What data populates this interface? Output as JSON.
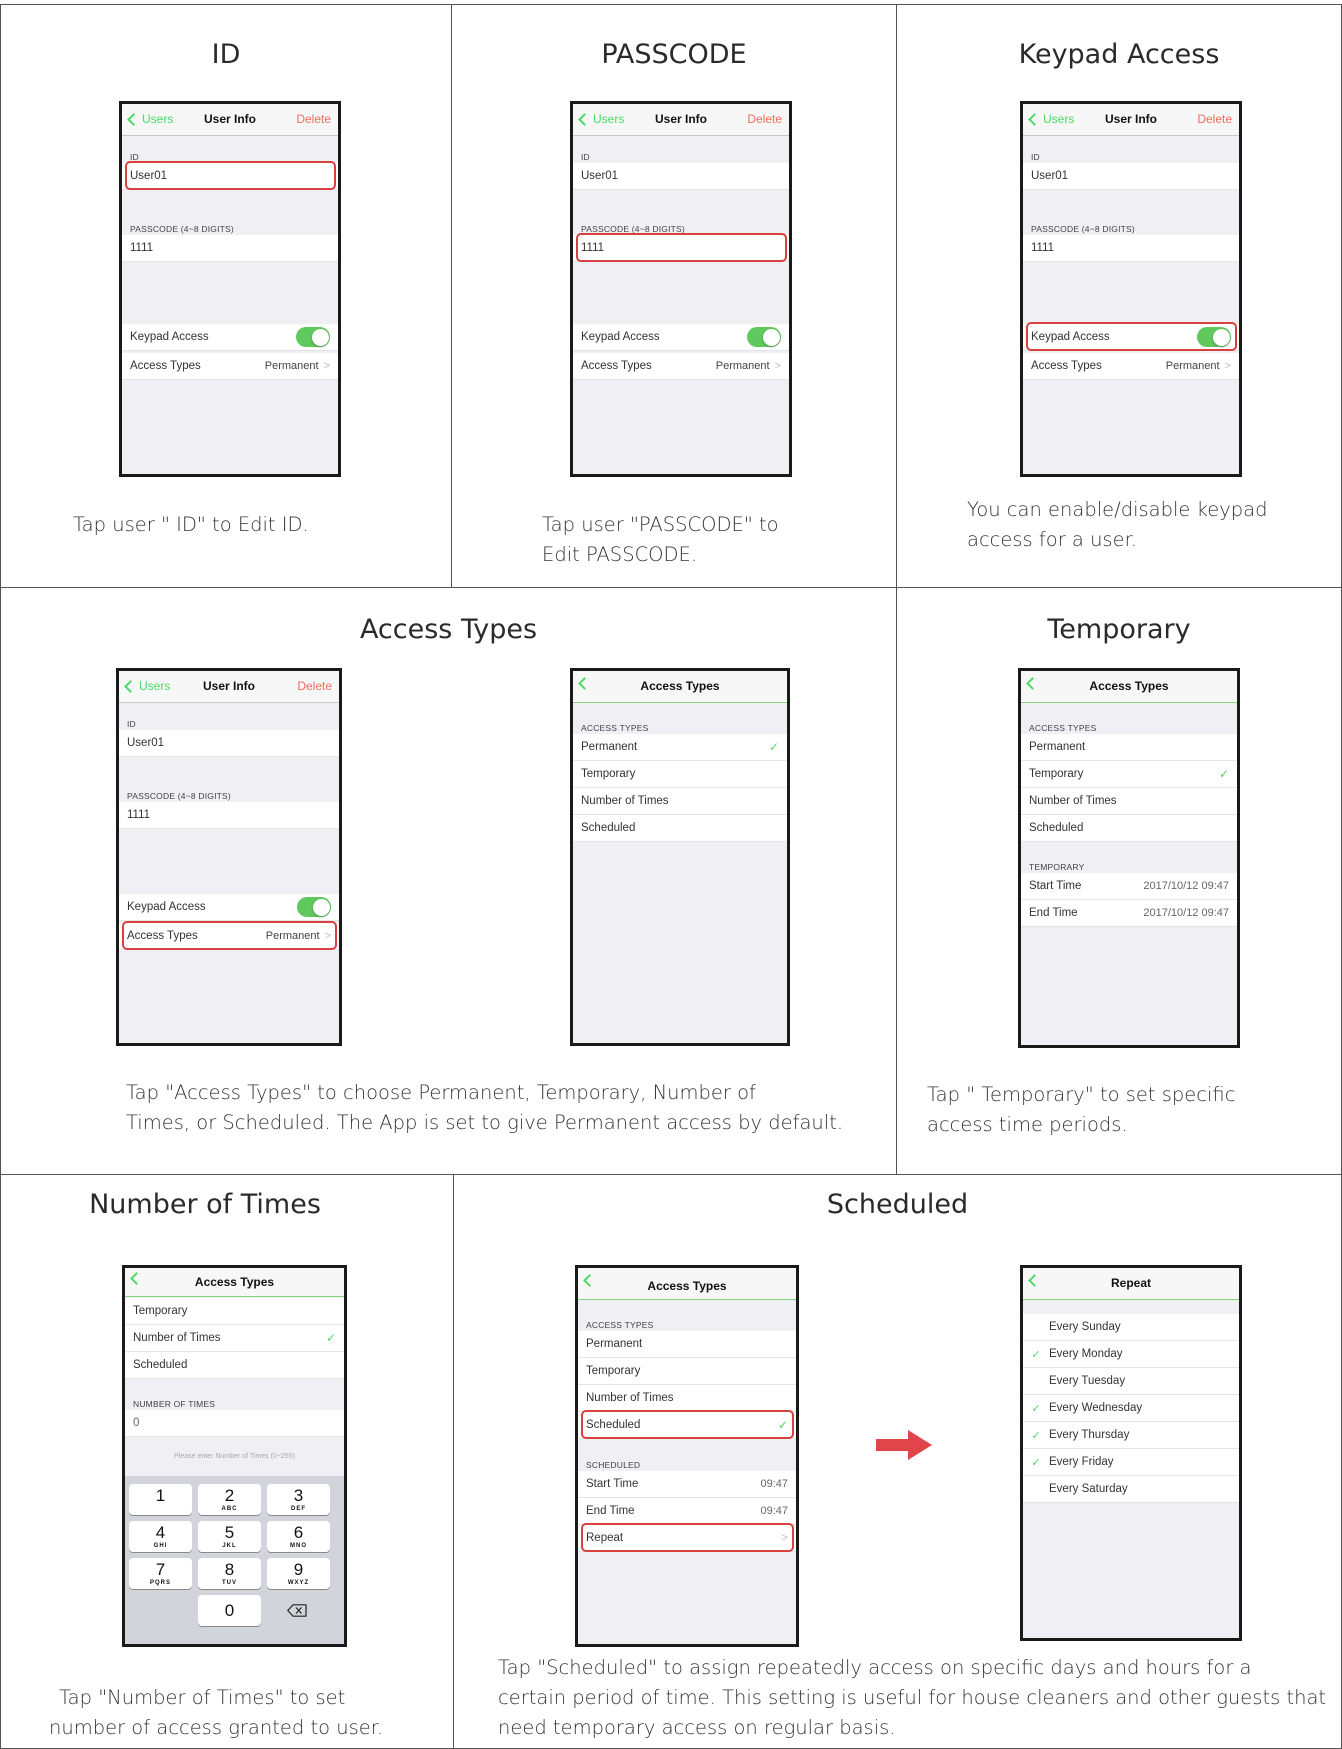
{
  "cells": {
    "id": {
      "title": "ID",
      "caption": "Tap user \" ID\" to Edit ID."
    },
    "passcode": {
      "title": "PASSCODE",
      "caption_line1": "Tap user \"PASSCODE\" to",
      "caption_line2": "Edit PASSCODE."
    },
    "keypad": {
      "title": "Keypad Access",
      "caption_line1": "You can enable/disable keypad",
      "caption_line2": "access for a user."
    },
    "access_types": {
      "title": "Access Types",
      "caption_line1": "Tap \"Access Types\" to choose Permanent, Temporary, Number of",
      "caption_line2": "Times, or Scheduled. The App is set to give Permanent access by default."
    },
    "temporary": {
      "title": "Temporary",
      "caption_line1": "Tap  \" Temporary\"  to set specific",
      "caption_line2": "access time periods."
    },
    "number_of_times": {
      "title": "Number of Times",
      "caption_line1": "Tap \"Number of Times\" to set",
      "caption_line2": "number of access granted to user."
    },
    "scheduled": {
      "title": "Scheduled",
      "caption_line1": "Tap  \"Scheduled\"  to assign repeatedly access on specific days and hours for a",
      "caption_line2": "certain period of time. This setting is useful for house cleaners and other guests that",
      "caption_line3": "need temporary access on regular basis."
    }
  },
  "user_info": {
    "back": "Users",
    "title": "User Info",
    "delete": "Delete",
    "id_label": "ID",
    "id_value": "User01",
    "passcode_label": "PASSCODE (4~8 DIGITS)",
    "passcode_value": "1111",
    "keypad_label": "Keypad Access",
    "access_types_label": "Access Types",
    "access_types_value": "Permanent"
  },
  "access_types_screen": {
    "title": "Access Types",
    "section": "ACCESS TYPES",
    "options": [
      "Permanent",
      "Temporary",
      "Number of Times",
      "Scheduled"
    ],
    "temporary_section": "TEMPORARY",
    "start_time_label": "Start Time",
    "end_time_label": "End Time",
    "temporary_start": "2017/10/12 09:47",
    "temporary_end": "2017/10/12 09:47",
    "number_section": "NUMBER OF TIMES",
    "number_value": "0",
    "number_hint": "Please enter Number of Times (0~255)",
    "scheduled_section": "SCHEDULED",
    "scheduled_start": "09:47",
    "scheduled_end": "09:47",
    "repeat_label": "Repeat",
    "check": "✓"
  },
  "keypad_keys": [
    {
      "num": "1",
      "sub": ""
    },
    {
      "num": "2",
      "sub": "ABC"
    },
    {
      "num": "3",
      "sub": "DEF"
    },
    {
      "num": "4",
      "sub": "GHI"
    },
    {
      "num": "5",
      "sub": "JKL"
    },
    {
      "num": "6",
      "sub": "MNO"
    },
    {
      "num": "7",
      "sub": "PQRS"
    },
    {
      "num": "8",
      "sub": "TUV"
    },
    {
      "num": "9",
      "sub": "WXYZ"
    },
    {
      "num": "0",
      "sub": ""
    }
  ],
  "repeat_screen": {
    "title": "Repeat",
    "days": [
      {
        "label": "Every Sunday",
        "checked": false
      },
      {
        "label": "Every Monday",
        "checked": true
      },
      {
        "label": "Every Tuesday",
        "checked": false
      },
      {
        "label": "Every Wednesday",
        "checked": true
      },
      {
        "label": "Every Thursday",
        "checked": true
      },
      {
        "label": "Every Friday",
        "checked": true
      },
      {
        "label": "Every Saturday",
        "checked": false
      }
    ]
  },
  "colors": {
    "accent_green": "#4cd964",
    "delete_red": "#f06b5d",
    "highlight_red": "#d8413d",
    "arrow_red": "#e2444b"
  },
  "icons": {
    "back": "chevron-left-icon",
    "toggle": "toggle-switch-on",
    "disclosure": "chevron-right-icon",
    "check": "checkmark-icon",
    "arrow": "right-arrow-icon",
    "backspace": "backspace-icon"
  }
}
